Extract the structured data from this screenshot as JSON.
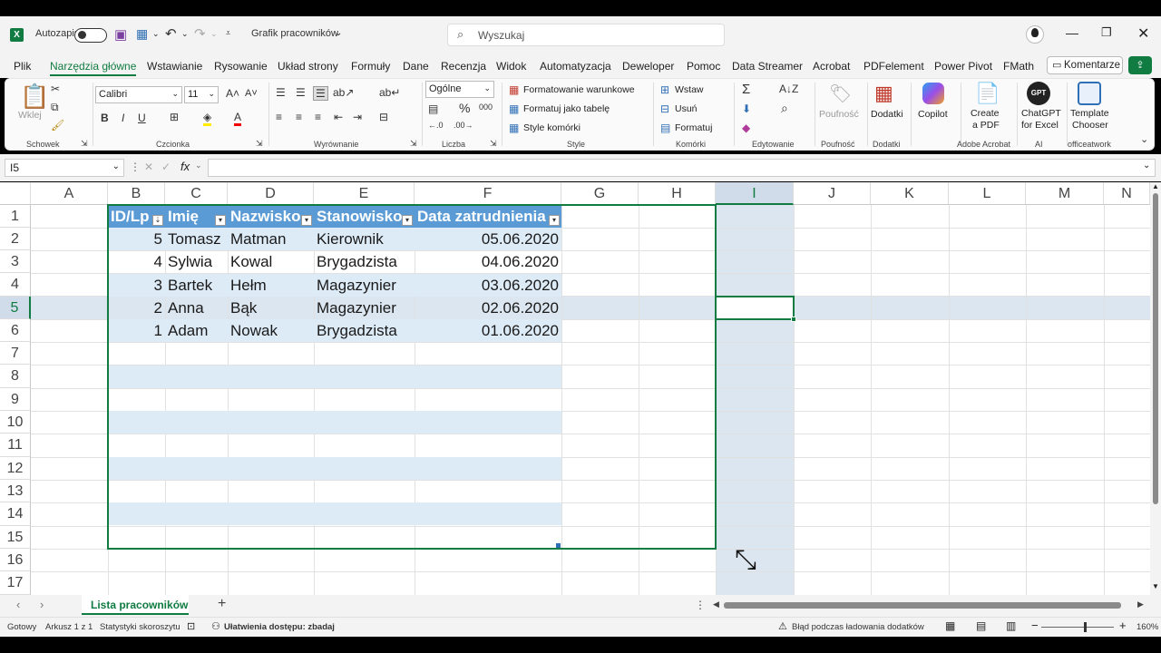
{
  "window": {
    "autosave_label": "Autozapis",
    "file_title": "Grafik pracowników",
    "search_placeholder": "Wyszukaj"
  },
  "menu": {
    "items": [
      "Plik",
      "Narzędzia główne",
      "Wstawianie",
      "Rysowanie",
      "Układ strony",
      "Formuły",
      "Dane",
      "Recenzja",
      "Widok",
      "Automatyzacja",
      "Deweloper",
      "Pomoc",
      "Data Streamer",
      "Acrobat",
      "PDFelement",
      "Power Pivot",
      "FMath"
    ],
    "active": "Narzędzia główne",
    "comments_label": "Komentarze"
  },
  "ribbon": {
    "groups": {
      "clipboard": "Schowek",
      "font": "Czcionka",
      "alignment": "Wyrównanie",
      "number": "Liczba",
      "styles": "Style",
      "cells": "Komórki",
      "editing": "Edytowanie",
      "sensitivity": "Poufność",
      "addins": "Dodatki",
      "acrobat": "Adobe Acrobat",
      "ai": "AI",
      "officeatwork": "officeatwork"
    },
    "paste_label": "Wklej",
    "font_name": "Calibri",
    "font_size": "11",
    "number_format": "Ogólne",
    "conditional_formatting": "Formatowanie warunkowe",
    "format_as_table": "Formatuj jako tabelę",
    "cell_styles": "Style komórki",
    "insert": "Wstaw",
    "delete": "Usuń",
    "format": "Formatuj",
    "sensitivity_btn": "Poufność",
    "addins_btn": "Dodatki",
    "copilot_btn": "Copilot",
    "create_pdf_line1": "Create",
    "create_pdf_line2": "a PDF",
    "chatgpt_line1": "ChatGPT",
    "chatgpt_line2": "for Excel",
    "template_line1": "Template",
    "template_line2": "Chooser"
  },
  "formula_bar": {
    "name_box": "I5",
    "fx": "fx",
    "formula": ""
  },
  "columns": [
    "A",
    "B",
    "C",
    "D",
    "E",
    "F",
    "G",
    "H",
    "I",
    "J",
    "K",
    "L",
    "M",
    "N"
  ],
  "rows": [
    "1",
    "2",
    "3",
    "4",
    "5",
    "6",
    "7",
    "8",
    "9",
    "10",
    "11",
    "12",
    "13",
    "14",
    "15",
    "16",
    "17"
  ],
  "table": {
    "headers": [
      "ID/Lp",
      "Imię",
      "Nazwisko",
      "Stanowisko",
      "Data zatrudnienia"
    ],
    "rows": [
      [
        "5",
        "Tomasz",
        "Matman",
        "Kierownik",
        "05.06.2020"
      ],
      [
        "4",
        "Sylwia",
        "Kowal",
        "Brygadzista",
        "04.06.2020"
      ],
      [
        "3",
        "Bartek",
        "Hełm",
        "Magazynier",
        "03.06.2020"
      ],
      [
        "2",
        "Anna",
        "Bąk",
        "Magazynier",
        "02.06.2020"
      ],
      [
        "1",
        "Adam",
        "Nowak",
        "Brygadzista",
        "01.06.2020"
      ]
    ]
  },
  "sheet_tabs": {
    "active": "Lista pracowników"
  },
  "status": {
    "ready": "Gotowy",
    "sheet_info": "Arkusz 1 z 1",
    "workbook_stats": "Statystyki skoroszytu",
    "accessibility": "Ułatwienia dostępu: zbadaj",
    "addins_error": "Błąd podczas ładowania dodatków",
    "zoom": "160%"
  },
  "colors": {
    "accent": "#107c41",
    "table_header": "#5b9bd5",
    "band": "#ddebf7",
    "selection": "#dce6f0"
  }
}
